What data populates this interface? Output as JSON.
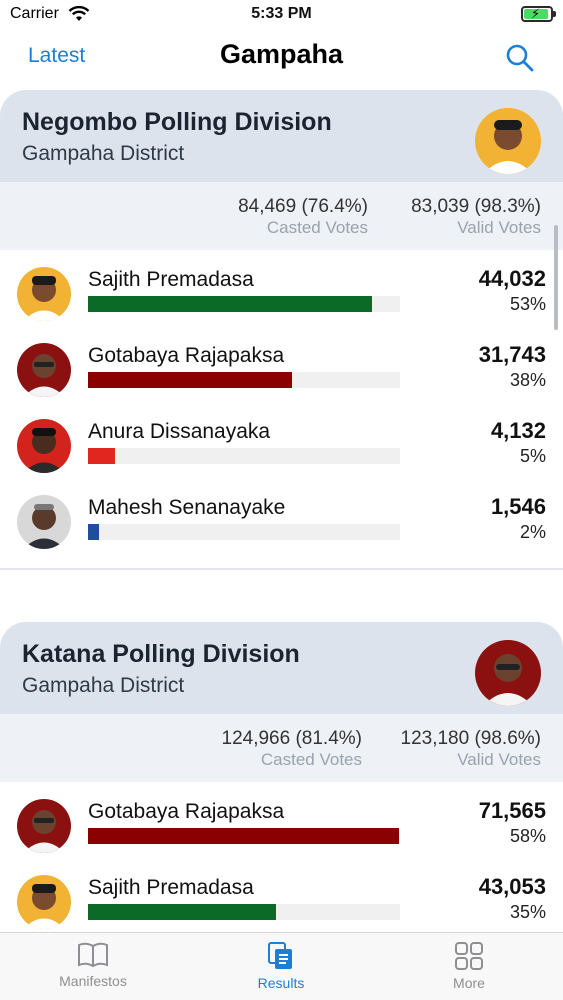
{
  "status_bar": {
    "carrier": "Carrier",
    "time": "5:33 PM"
  },
  "nav": {
    "back": "Latest",
    "title": "Gampaha"
  },
  "divisions": [
    {
      "title": "Negombo Polling Division",
      "district": "Gampaha District",
      "winner_avatar": "Sajith Premadasa",
      "casted": {
        "value": "84,469 (76.4%)",
        "label": "Casted Votes"
      },
      "valid": {
        "value": "83,039 (98.3%)",
        "label": "Valid Votes"
      },
      "candidates": [
        {
          "name": "Sajith Premadasa",
          "votes": "44,032",
          "percent": "53%",
          "share": 0.53,
          "color": "#0b6b26"
        },
        {
          "name": "Gotabaya Rajapaksa",
          "votes": "31,743",
          "percent": "38%",
          "share": 0.38,
          "color": "#8b0000"
        },
        {
          "name": "Anura Dissanayaka",
          "votes": "4,132",
          "percent": "5%",
          "share": 0.05,
          "color": "#e0261f"
        },
        {
          "name": "Mahesh Senanayake",
          "votes": "1,546",
          "percent": "2%",
          "share": 0.02,
          "color": "#1f4f9c"
        }
      ]
    },
    {
      "title": "Katana Polling Division",
      "district": "Gampaha District",
      "winner_avatar": "Gotabaya Rajapaksa",
      "casted": {
        "value": "124,966 (81.4%)",
        "label": "Casted Votes"
      },
      "valid": {
        "value": "123,180 (98.6%)",
        "label": "Valid Votes"
      },
      "candidates": [
        {
          "name": "Gotabaya Rajapaksa",
          "votes": "71,565",
          "percent": "58%",
          "share": 0.58,
          "color": "#8b0000"
        },
        {
          "name": "Sajith Premadasa",
          "votes": "43,053",
          "percent": "35%",
          "share": 0.35,
          "color": "#0b6b26"
        }
      ]
    }
  ],
  "tabs": [
    {
      "label": "Manifestos",
      "icon": "book-icon",
      "active": false
    },
    {
      "label": "Results",
      "icon": "documents-icon",
      "active": true
    },
    {
      "label": "More",
      "icon": "grid-icon",
      "active": false
    }
  ],
  "colors": {
    "accent": "#1a7fd6",
    "header_bg": "#dde3ec",
    "stats_bg": "#eef1f6"
  }
}
